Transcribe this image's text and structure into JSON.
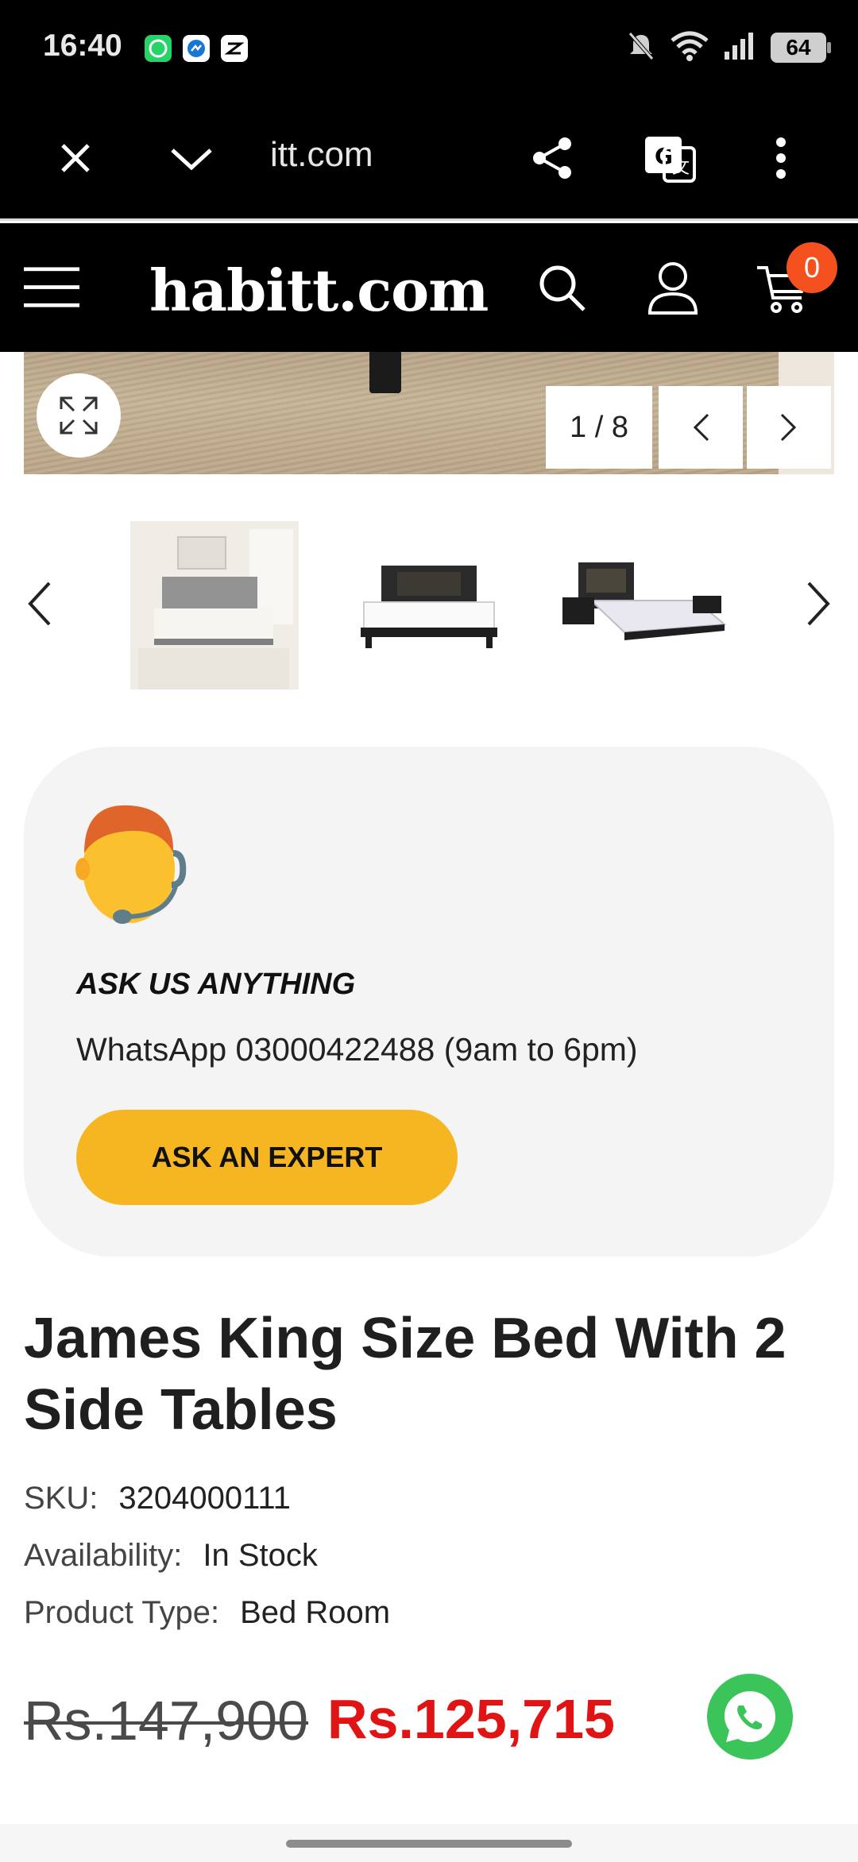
{
  "status_bar": {
    "time": "16:40",
    "battery": "64",
    "notification_icons": [
      "whatsapp-icon",
      "messenger-icon",
      "capcut-icon"
    ],
    "system_icons": [
      "mute-icon",
      "wifi-icon",
      "signal-icon",
      "battery-icon"
    ]
  },
  "browser": {
    "url": "itt.com",
    "icons": [
      "close-icon",
      "chevron-down-icon",
      "share-icon",
      "translate-icon",
      "more-vert-icon"
    ]
  },
  "site_header": {
    "logo": "habitt.com",
    "cart_count": "0",
    "icons": [
      "menu-icon",
      "search-icon",
      "account-icon",
      "cart-icon"
    ]
  },
  "gallery": {
    "counter": "1 / 8",
    "thumbnails": [
      "bed-lifestyle-thumbnail",
      "bed-front-thumbnail",
      "bed-angle-thumbnail"
    ]
  },
  "ask_card": {
    "title": "ASK US ANYTHING",
    "whatsapp_line": "WhatsApp 03000422488 (9am to 6pm)",
    "button_label": "ASK AN EXPERT"
  },
  "product": {
    "title": "James King Size Bed With 2 Side Tables",
    "sku_label": "SKU:",
    "sku_value": "3204000111",
    "availability_label": "Availability:",
    "availability_value": "In Stock",
    "type_label": "Product Type:",
    "type_value": "Bed Room",
    "old_price": "Rs.147,900",
    "new_price": "Rs.125,715"
  },
  "colors": {
    "accent_yellow": "#f5b621",
    "price_red": "#e01414",
    "cart_badge": "#f4511e",
    "whatsapp_green": "#3bc45a"
  }
}
